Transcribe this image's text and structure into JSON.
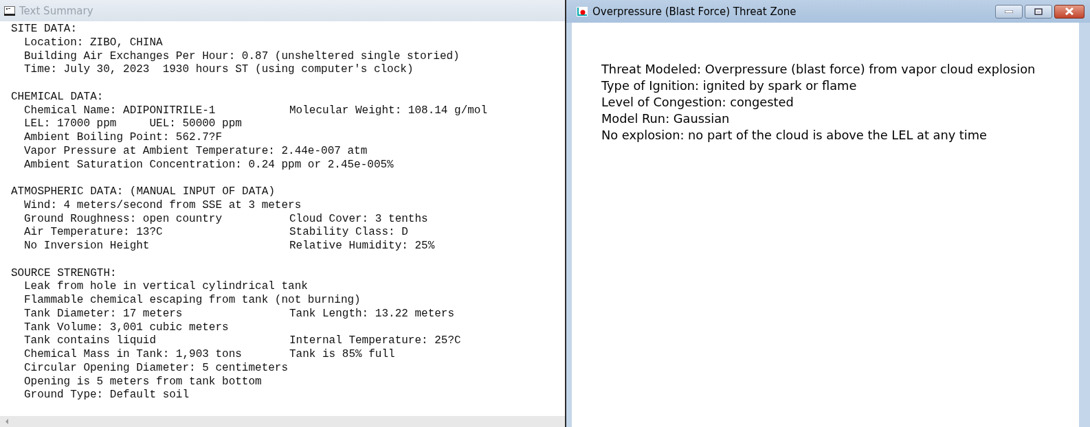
{
  "summary_window": {
    "title": "Text Summary",
    "active": false,
    "sections": [
      {
        "heading": "SITE DATA:",
        "lines": [
          {
            "text": "Location: ZIBO, CHINA"
          },
          {
            "text": "Building Air Exchanges Per Hour: 0.87 (unsheltered single storied)"
          },
          {
            "text": "Time: July 30, 2023  1930 hours ST (using computer's clock)"
          }
        ]
      },
      {
        "heading": "CHEMICAL DATA:",
        "lines": [
          {
            "text": "Chemical Name: ADIPONITRILE-1",
            "right": "Molecular Weight: 108.14 g/mol"
          },
          {
            "text": "LEL: 17000 ppm     UEL: 50000 ppm"
          },
          {
            "text": "Ambient Boiling Point: 562.7?F"
          },
          {
            "text": "Vapor Pressure at Ambient Temperature: 2.44e-007 atm"
          },
          {
            "text": "Ambient Saturation Concentration: 0.24 ppm or 2.45e-005%"
          }
        ]
      },
      {
        "heading": "ATMOSPHERIC DATA: (MANUAL INPUT OF DATA)",
        "lines": [
          {
            "text": "Wind: 4 meters/second from SSE at 3 meters"
          },
          {
            "text": "Ground Roughness: open country",
            "right": "Cloud Cover: 3 tenths"
          },
          {
            "text": "Air Temperature: 13?C",
            "right": "Stability Class: D"
          },
          {
            "text": "No Inversion Height",
            "right": "Relative Humidity: 25%"
          }
        ]
      },
      {
        "heading": "SOURCE STRENGTH:",
        "lines": [
          {
            "text": "Leak from hole in vertical cylindrical tank"
          },
          {
            "text": "Flammable chemical escaping from tank (not burning)"
          },
          {
            "text": "Tank Diameter: 17 meters",
            "right": "Tank Length: 13.22 meters"
          },
          {
            "text": "Tank Volume: 3,001 cubic meters"
          },
          {
            "text": "Tank contains liquid",
            "right": "Internal Temperature: 25?C"
          },
          {
            "text": "Chemical Mass in Tank: 1,903 tons",
            "right": "Tank is 85% full"
          },
          {
            "text": "Circular Opening Diameter: 5 centimeters"
          },
          {
            "text": "Opening is 5 meters from tank bottom"
          },
          {
            "text": "Ground Type: Default soil"
          }
        ]
      }
    ]
  },
  "threat_window": {
    "title": "Overpressure (Blast Force) Threat Zone",
    "active": true,
    "lines": [
      "Threat Modeled: Overpressure (blast force) from vapor cloud explosion",
      "Type of Ignition: ignited by spark or flame",
      "Level of Congestion: congested",
      "Model Run: Gaussian",
      "No explosion: no part of the cloud is above the LEL at any time"
    ]
  }
}
